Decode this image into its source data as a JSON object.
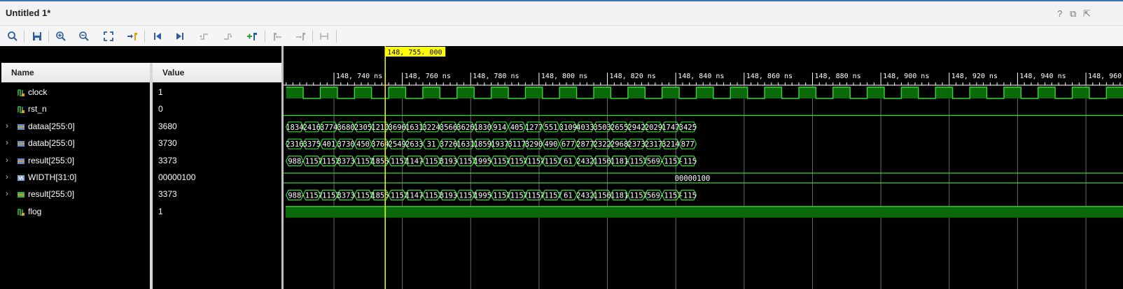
{
  "window": {
    "title": "Untitled 1*",
    "controls": [
      {
        "name": "help-icon",
        "glyph": "?"
      },
      {
        "name": "restore-icon",
        "glyph": "⧉"
      },
      {
        "name": "maximize-icon",
        "glyph": "⇱"
      }
    ]
  },
  "toolbar": {
    "buttons": [
      {
        "name": "search-icon"
      },
      {
        "name": "save-icon"
      },
      {
        "name": "zoom-in-icon"
      },
      {
        "name": "zoom-out-icon"
      },
      {
        "name": "zoom-fit-icon"
      },
      {
        "name": "go-to-cursor-icon"
      },
      {
        "name": "go-to-time-zero-icon"
      },
      {
        "name": "go-to-last-time-icon"
      },
      {
        "name": "previous-transition-icon"
      },
      {
        "name": "next-transition-icon"
      },
      {
        "name": "add-marker-icon"
      },
      {
        "name": "previous-marker-icon"
      },
      {
        "name": "next-marker-icon"
      },
      {
        "name": "swap-cursors-icon"
      }
    ]
  },
  "columns": {
    "name": "Name",
    "value": "Value"
  },
  "signals": [
    {
      "name": "clock",
      "value": "1",
      "type": "bit",
      "expandable": false,
      "icon": "bit-signal-icon"
    },
    {
      "name": "rst_n",
      "value": "0",
      "type": "bit",
      "expandable": false,
      "icon": "bit-signal-icon"
    },
    {
      "name": "dataa[255:0]",
      "value": "3680",
      "type": "bus",
      "expandable": true,
      "icon": "bus-signal-icon"
    },
    {
      "name": "datab[255:0]",
      "value": "3730",
      "type": "bus",
      "expandable": true,
      "icon": "bus-signal-icon"
    },
    {
      "name": "result[255:0]",
      "value": "3373",
      "type": "bus",
      "expandable": true,
      "icon": "bus-signal-icon"
    },
    {
      "name": "WIDTH[31:0]",
      "value": "00000100",
      "type": "bus",
      "expandable": true,
      "icon": "parameter-icon"
    },
    {
      "name": "result[255:0]",
      "value": "3373",
      "type": "bus",
      "expandable": true,
      "icon": "bus-output-icon"
    },
    {
      "name": "flog",
      "value": "1",
      "type": "bit",
      "expandable": false,
      "icon": "bit-signal-icon"
    }
  ],
  "waveform": {
    "cursor_label": "148, 755. 000 ns",
    "cursor_time_ns": 148755,
    "time_labels": [
      "148, 740 ns",
      "148, 760 ns",
      "148, 780 ns",
      "148, 800 ns",
      "148, 820 ns",
      "148, 840 ns",
      "148, 860 ns",
      "148, 880 ns",
      "148, 900 ns",
      "148, 920 ns",
      "148, 940 ns",
      "148, 960 ns"
    ],
    "first_label_time_ns": 148740,
    "label_step_ns": 20,
    "clock_period_ns": 10,
    "bus_segment_ns": 5,
    "dataa": [
      "1834",
      "2416",
      "3774",
      "3680",
      "2305",
      "1210",
      "3696",
      "1631",
      "3224",
      "3566",
      "3626",
      "1830",
      "914",
      "405",
      "1277",
      "551",
      "3109",
      "4033",
      "3503",
      "2655",
      "2942",
      "2029",
      "1747",
      "3425"
    ],
    "datab": [
      "2316",
      "3375",
      "401",
      "3730",
      "450",
      "3764",
      "2549",
      "2633",
      "31",
      "3726",
      "1631",
      "1859",
      "1937",
      "3117",
      "3290",
      "490",
      "677",
      "2877",
      "2322",
      "2968",
      "2373",
      "2317",
      "3214",
      "877"
    ],
    "result": [
      "988",
      "-1157",
      "-1157",
      "3373",
      "-1157",
      "1855",
      "-1157",
      "1147",
      "-1157",
      "3193",
      "-1157",
      "1995",
      "-1157",
      "-1157",
      "-1157",
      "-1157",
      "61",
      "2432",
      "1156",
      "1181",
      "-1157",
      "569",
      "-1157",
      "-115"
    ],
    "width_value": "00000100",
    "result2": [
      "988",
      "-1157",
      "-1157",
      "3373",
      "-1157",
      "1855",
      "-1157",
      "1147",
      "-1157",
      "3193",
      "-1157",
      "1995",
      "-1157",
      "-1157",
      "-1157",
      "-1157",
      "61",
      "2432",
      "1156",
      "1181",
      "-1157",
      "569",
      "-1157",
      "-115"
    ],
    "colors": {
      "wave": "#39d439",
      "fill": "#0a6a0a",
      "cursor": "#ffff00",
      "cursor_label_bg": "#ffff00",
      "grid": "#6b6b6b",
      "text": "#ffffff"
    }
  }
}
